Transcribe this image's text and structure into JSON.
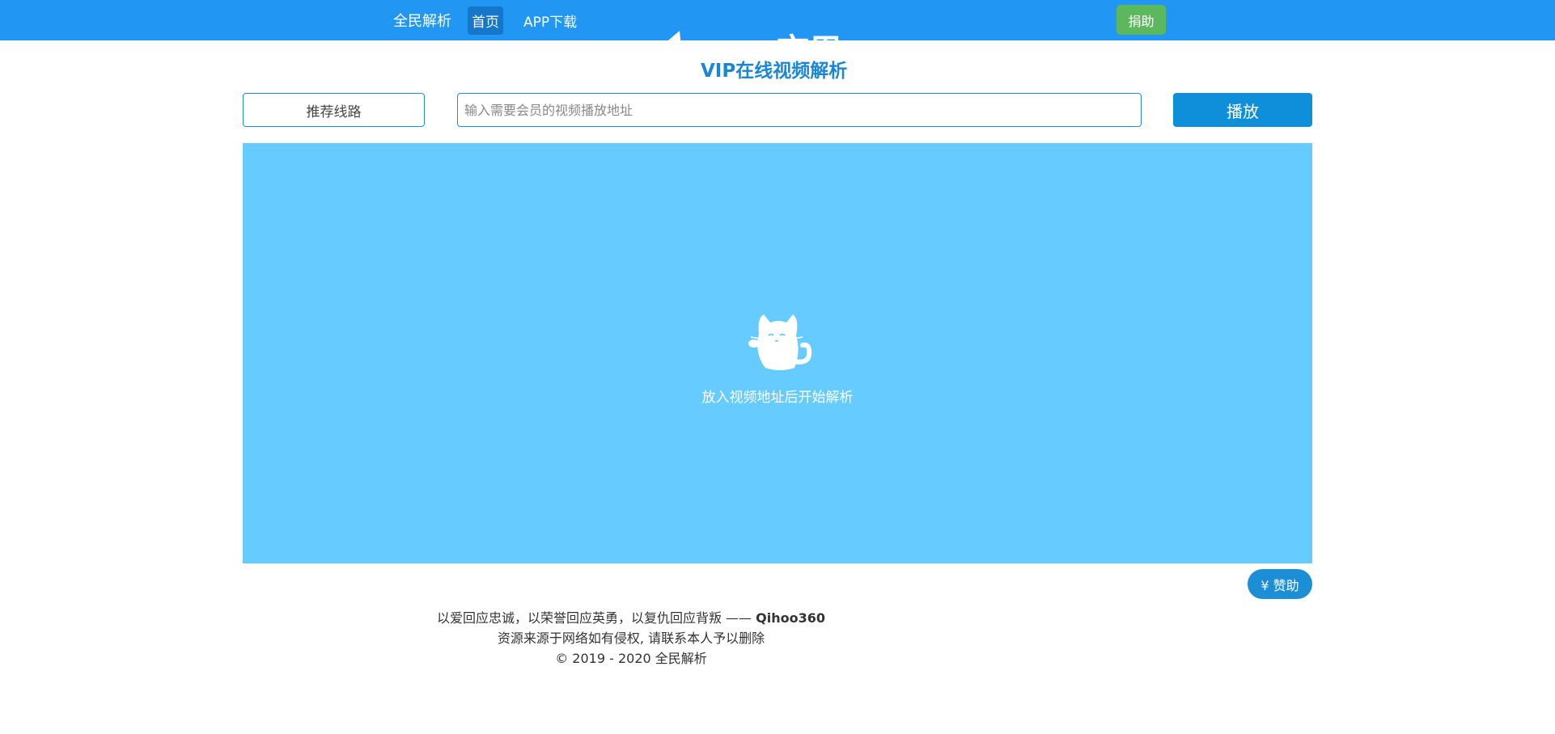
{
  "nav": {
    "brand": "全民解析",
    "links": [
      {
        "label": "首页",
        "active": true
      },
      {
        "label": "APP下载",
        "active": false
      }
    ],
    "donate_label": "捐助"
  },
  "logo": {
    "title": "VIP在线视频解析",
    "ghost_text": "市用"
  },
  "controls": {
    "route_label": "推荐线路",
    "url_placeholder": "输入需要会员的视频播放地址",
    "url_value": "",
    "play_label": "播放"
  },
  "player": {
    "hint": "放入视频地址后开始解析",
    "icon": "cat-mascot-icon"
  },
  "support": {
    "label": "¥ 赞助"
  },
  "footer": {
    "quote": "以爱回应忠诚，以荣誉回应英勇，以复仇回应背叛 ——",
    "author": "Qihoo360",
    "disclaimer": "资源来源于网络如有侵权, 请联系本人予以删除",
    "copyright": "© 2019 - 2020 全民解析"
  },
  "colors": {
    "navbar": "#2196f3",
    "accent": "#0f8ed9",
    "player_bg": "#66ccff",
    "donate": "#5cb85c",
    "title": "#1a87d6"
  }
}
